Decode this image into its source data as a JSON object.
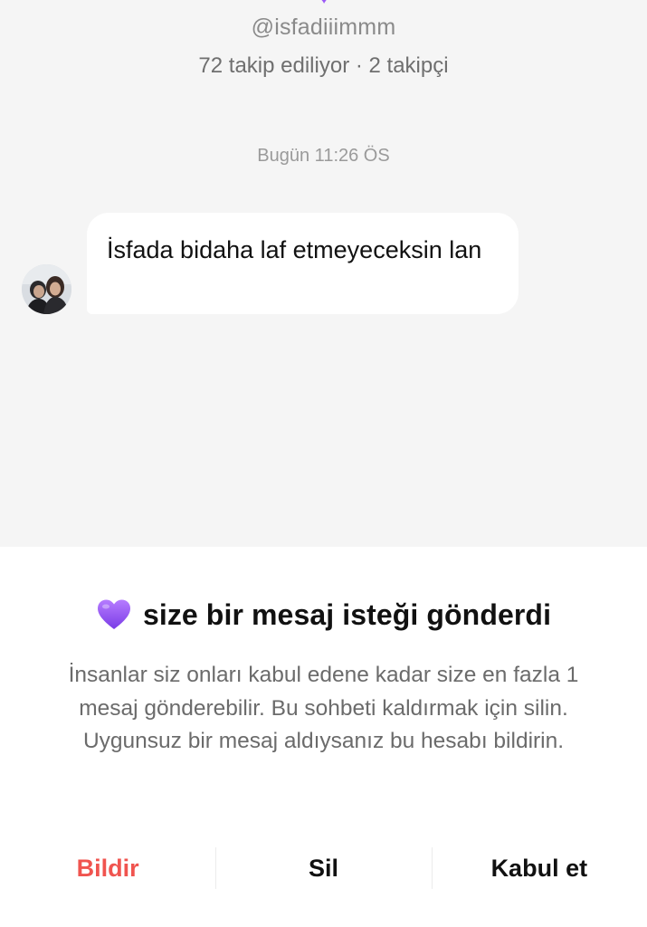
{
  "profile": {
    "username": "@isfadiiimmm",
    "follow_stats": "72 takip ediliyor · 2 takipçi"
  },
  "chat": {
    "timestamp": "Bugün 11:26 ÖS",
    "messages": [
      {
        "text": "İsfada bidaha laf etmeyeceksin lan"
      }
    ]
  },
  "request_sheet": {
    "title": "size bir mesaj isteği gönderdi",
    "title_emoji": "purple-heart-icon",
    "description": "İnsanlar siz onları kabul edene kadar size en fazla 1 mesaj gönderebilir. Bu sohbeti kaldırmak için silin. Uygunsuz bir mesaj aldıysanız bu hesabı bildirin.",
    "actions": {
      "report_label": "Bildir",
      "delete_label": "Sil",
      "accept_label": "Kabul et"
    }
  },
  "colors": {
    "report": "#f0544f",
    "heart": "#9b59f6",
    "chat_background": "#f5f5f5"
  }
}
